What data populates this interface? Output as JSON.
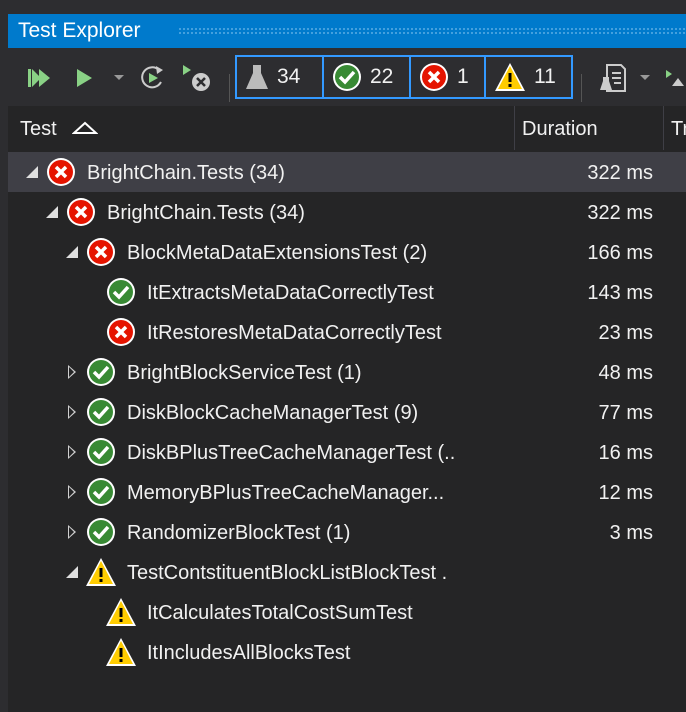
{
  "window": {
    "title": "Test Explorer"
  },
  "toolbar": {
    "run_all": "run-all-icon",
    "run": "run-icon",
    "repeat": "repeat-last-run-icon",
    "cancel": "cancel-run-icon",
    "playlist": "playlist-icon",
    "filters": [
      {
        "name": "total",
        "icon": "flask-icon",
        "count": "34"
      },
      {
        "name": "passed",
        "icon": "passed-icon",
        "count": "22"
      },
      {
        "name": "failed",
        "icon": "failed-icon",
        "count": "1"
      },
      {
        "name": "not-run",
        "icon": "warning-icon",
        "count": "11"
      }
    ]
  },
  "columns": {
    "test": "Test",
    "duration": "Duration",
    "traits": "Tr"
  },
  "colors": {
    "accent": "#007acc",
    "passed": "#388a34",
    "failed": "#e51400",
    "warning": "#ffcc00",
    "filter_border": "#3399ff"
  },
  "rows": [
    {
      "level": 0,
      "expander": "open",
      "status": "failed",
      "label": "BrightChain.Tests  (34)",
      "duration": "322 ms",
      "selected": true
    },
    {
      "level": 1,
      "expander": "open",
      "status": "failed",
      "label": "BrightChain.Tests  (34)",
      "duration": "322 ms"
    },
    {
      "level": 2,
      "expander": "open",
      "status": "failed",
      "label": "BlockMetaDataExtensionsTest  (2)",
      "duration": "166 ms"
    },
    {
      "level": 3,
      "expander": "none",
      "status": "passed",
      "label": "ItExtractsMetaDataCorrectlyTest",
      "duration": "143 ms"
    },
    {
      "level": 3,
      "expander": "none",
      "status": "failed",
      "label": "ItRestoresMetaDataCorrectlyTest",
      "duration": "23 ms"
    },
    {
      "level": 2,
      "expander": "closed",
      "status": "passed",
      "label": "BrightBlockServiceTest  (1)",
      "duration": "48 ms"
    },
    {
      "level": 2,
      "expander": "closed",
      "status": "passed",
      "label": "DiskBlockCacheManagerTest  (9)",
      "duration": "77 ms"
    },
    {
      "level": 2,
      "expander": "closed",
      "status": "passed",
      "label": "DiskBPlusTreeCacheManagerTest  (..",
      "duration": "16 ms"
    },
    {
      "level": 2,
      "expander": "closed",
      "status": "passed",
      "label": "MemoryBPlusTreeCacheManager...",
      "duration": "12 ms"
    },
    {
      "level": 2,
      "expander": "closed",
      "status": "passed",
      "label": "RandomizerBlockTest  (1)",
      "duration": "3 ms"
    },
    {
      "level": 2,
      "expander": "open",
      "status": "warning",
      "label": "TestContstituentBlockListBlockTest  .",
      "duration": ""
    },
    {
      "level": 3,
      "expander": "none",
      "status": "warning",
      "label": "ItCalculatesTotalCostSumTest",
      "duration": ""
    },
    {
      "level": 3,
      "expander": "none",
      "status": "warning",
      "label": "ItIncludesAllBlocksTest",
      "duration": ""
    }
  ]
}
